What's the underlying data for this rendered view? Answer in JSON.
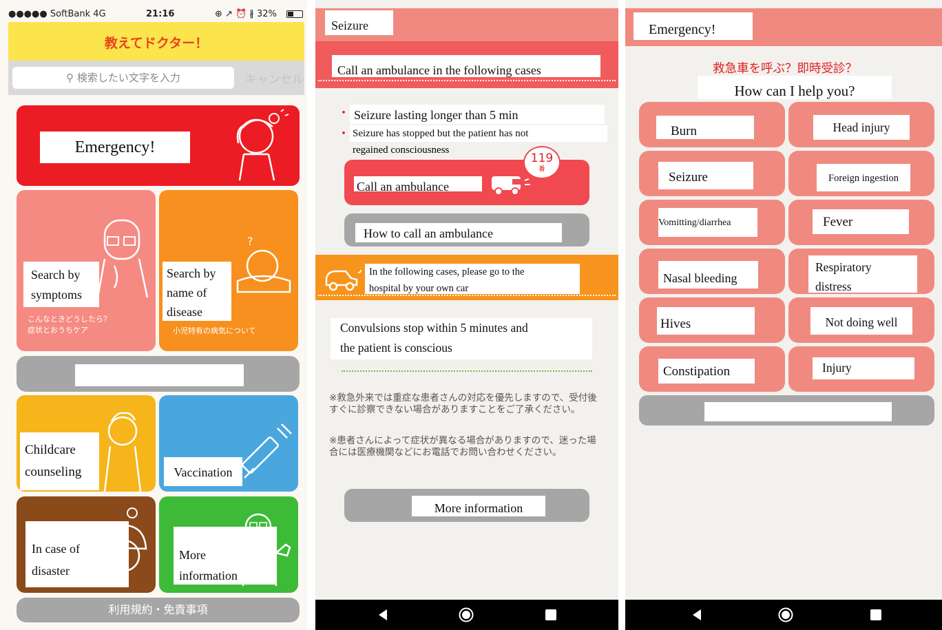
{
  "left": {
    "status": {
      "carrier": "●●●●● SoftBank  4G",
      "time": "21:16",
      "right": "⊕ ↗ ⏰ ∦ 32%"
    },
    "app_title": "教えてドクター！",
    "search": {
      "placeholder": "検索したい文字を入力",
      "cancel": "キャンセル"
    },
    "tiles": {
      "emergency": "Emergency!",
      "symptoms": {
        "line1": "Search by",
        "line2": "symptoms",
        "sub1": "こんなときどうしたら？",
        "sub2": "症状とおうちケア"
      },
      "disease": {
        "line1": "Search by",
        "line2": "name of",
        "line3": "disease",
        "sub": "小児特有の病気について"
      },
      "childcare": {
        "line1": "Childcare",
        "line2": "counseling"
      },
      "vaccination": "Vaccination",
      "disaster": {
        "line1": "In case of",
        "line2": "disaster"
      },
      "more": {
        "line1": "More",
        "line2": "information"
      }
    },
    "footer": "利用規約・免責事項"
  },
  "middle": {
    "header": "Seizure",
    "subheader": "Call an ambulance in the following cases",
    "bullets": {
      "b1": "Seizure lasting longer than 5 min",
      "b2a": "Seizure has  stopped but the patient has not",
      "b2b": "regained consciousness"
    },
    "badge_num": "119",
    "badge_sub": "番",
    "call_btn": "Call an ambulance",
    "how_btn": "How to call an ambulance",
    "car_line1": "In the following cases, please go to the",
    "car_line2": "hospital by your own car",
    "cond_line1": "Convulsions stop within 5 minutes and",
    "cond_line2": "the patient is conscious",
    "note1": "※救急外来では重症な患者さんの対応を優先しますので、受付後すぐに診察できない場合がありますことをご了承ください。",
    "note2": "※患者さんによって症状が異なる場合がありますので、迷った場合には医療機関などにお電話でお問い合わせください。",
    "more_btn": "More information"
  },
  "right": {
    "header": "Emergency!",
    "question_jp": "救急車を呼ぶ？即時受診？",
    "question_en": "How can I help you?",
    "items": {
      "burn": "Burn",
      "head": "Head injury",
      "seizure": "Seizure",
      "foreign": "Foreign ingestion",
      "vomit": "Vomitting/diarrhea",
      "fever": "Fever",
      "nasal": "Nasal bleeding",
      "resp1": "Respiratory",
      "resp2": "distress",
      "hives": "Hives",
      "notwell": "Not doing well",
      "constipation": "Constipation",
      "injury": "Injury"
    }
  },
  "colors": {
    "yellow_header": "#fce44c",
    "emergency_red": "#ec1c24",
    "symptom_pink": "#f58a82",
    "disease_orange": "#f7901e",
    "childcare_yellow": "#f5b51b",
    "vaccine_blue": "#4aa7dd",
    "disaster_brown": "#8a4a1a",
    "more_green": "#3dbb38",
    "salmon": "#f08a80",
    "gray": "#a6a6a6"
  }
}
